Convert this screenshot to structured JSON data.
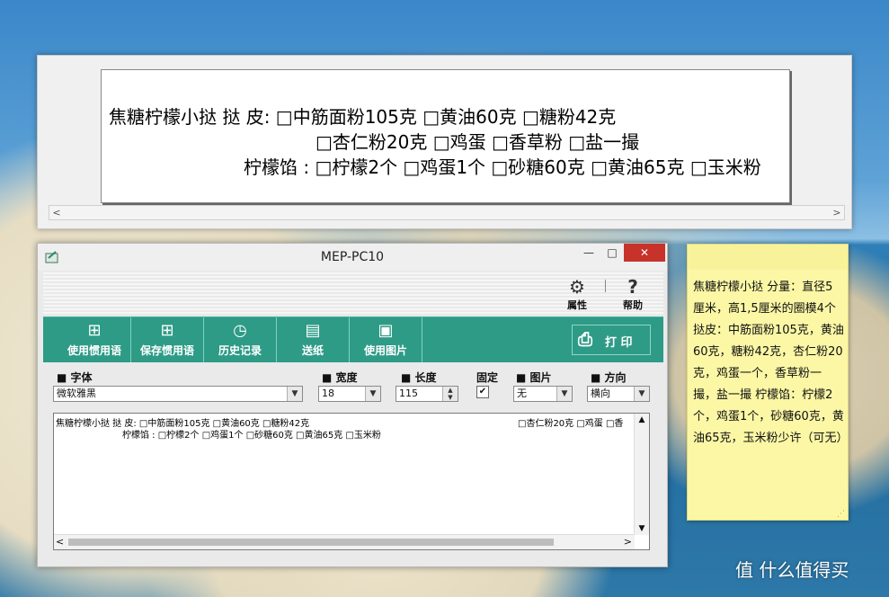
{
  "preview": {
    "line1": "焦糖柠檬小挞    挞    皮: □中筋面粉105克    □黄油60克    □糖粉42克",
    "line2": "□杏仁粉20克      □鸡蛋      □香草粉      □盐一撮",
    "line3": "柠檬馅 : □柠檬2个 □鸡蛋1个 □砂糖60克 □黄油65克 □玉米粉"
  },
  "window": {
    "title": "MEP-PC10",
    "minimize": "—",
    "maximize": "□",
    "close": "✕"
  },
  "upper": {
    "properties_icon": "⚙",
    "properties_label": "属性",
    "help_icon": "?",
    "help_label": "帮助"
  },
  "toolbar": {
    "buttons": [
      {
        "label": "使用惯用语",
        "icon": "⊞"
      },
      {
        "label": "保存惯用语",
        "icon": "⊞"
      },
      {
        "label": "历史记录",
        "icon": "◷"
      },
      {
        "label": "送纸",
        "icon": "▤"
      },
      {
        "label": "使用图片",
        "icon": "▣"
      }
    ],
    "print_icon": "⎙",
    "print_label": "打  印"
  },
  "fields": {
    "font_label": "■ 字体",
    "font_value": "微软雅黑",
    "width_label": "■ 宽度",
    "width_value": "18",
    "length_label": "■ 长度",
    "length_value": "115",
    "fixed_label": "固定",
    "fixed_checked": true,
    "image_label": "■ 图片",
    "image_value": "无",
    "direction_label": "■ 方向",
    "direction_value": "横向"
  },
  "editor": {
    "line1": "焦糖柠檬小挞    挞    皮: □中筋面粉105克    □黄油60克    □糖粉42克",
    "line1b": "□杏仁粉20克    □鸡蛋    □香",
    "line2": "柠檬馅 : □柠檬2个 □鸡蛋1个 □砂糖60克 □黄油65克 □玉米粉"
  },
  "note": {
    "text": "焦糖柠檬小挞 分量：直径5厘米，高1,5厘米的圈模4个 挞皮：中筋面粉105克，黄油60克，糖粉42克，杏仁粉20克，鸡蛋一个，香草粉一撮，盐一撮 柠檬馅：柠檬2个，鸡蛋1个，砂糖60克，黄油65克，玉米粉少许（可无）"
  },
  "watermark": "值 什么值得买"
}
